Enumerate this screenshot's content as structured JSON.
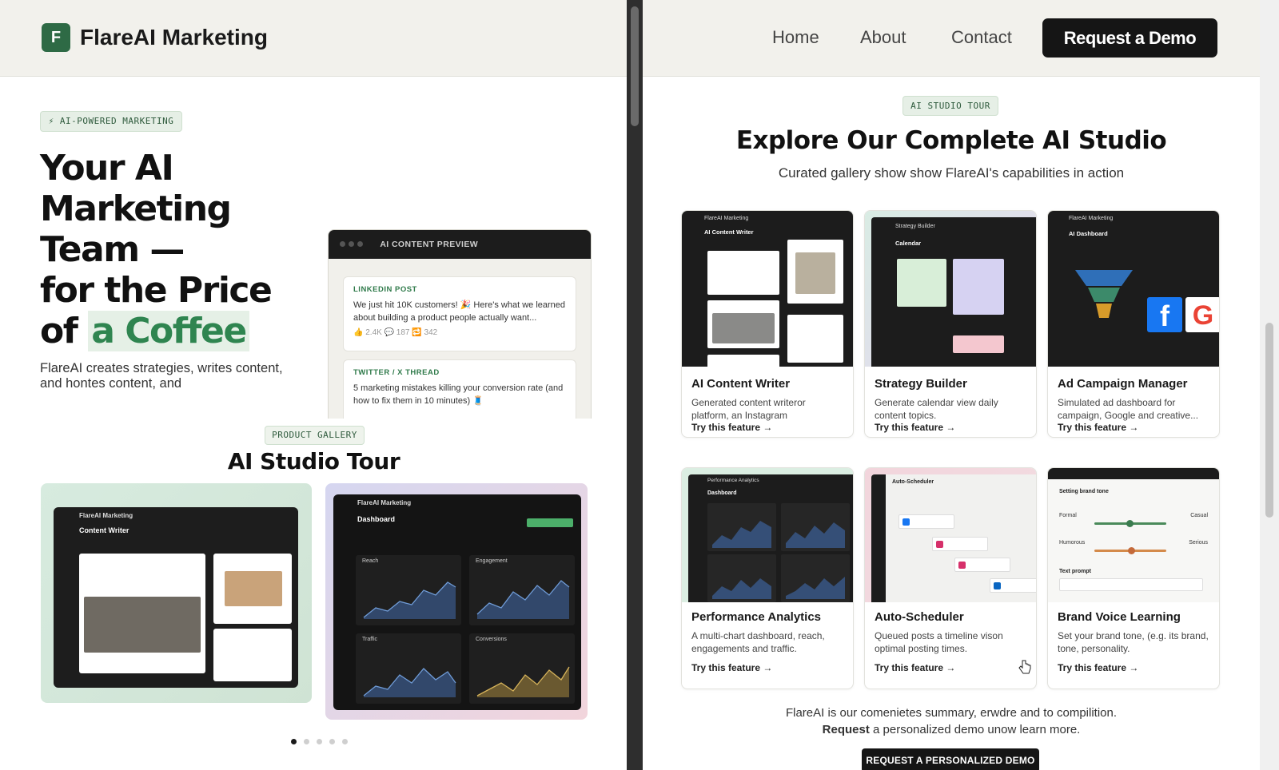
{
  "left": {
    "brand": {
      "initial": "F",
      "name": "FlareAI Marketing"
    },
    "badge": "⚡ AI-POWERED MARKETING",
    "hero": {
      "line1": "Your AI",
      "line2": "Marketing",
      "line3": "Team —",
      "line4": "for the Price",
      "line5_pre": "of ",
      "line5_hl": "a Coffee"
    },
    "lede": "FlareAI creates strategies, writes content, and hontes content, and",
    "preview": {
      "title": "AI CONTENT PREVIEW",
      "cards": [
        {
          "tag": "LINKEDIN POST",
          "body": "We just hit 10K customers! 🎉 Here's what we learned about building a product people actually want...",
          "meta": "👍 2.4K  💬 187  🔁 342"
        },
        {
          "tag": "TWITTER / X THREAD",
          "body": "5 marketing mistakes killing your conversion rate (and how to fix them in 10 minutes) 🧵",
          "meta": ""
        }
      ]
    },
    "gallery": {
      "badge": "PRODUCT GALLERY",
      "title": "AI Studio Tour",
      "shots": [
        {
          "app": "FlareAI Marketing",
          "screen": "Content Writer"
        },
        {
          "app": "FlareAI Marketing",
          "screen": "Dashboard",
          "panels": [
            "Reach",
            "Engagement",
            "Traffic",
            "Conversions"
          ]
        }
      ],
      "dots": 5,
      "active_dot": 1
    }
  },
  "right": {
    "nav": {
      "home": "Home",
      "about": "About",
      "contact": "Contact",
      "cta": "Request a Demo"
    },
    "badge": "AI STUDIO TOUR",
    "title": "Explore Our Complete AI Studio",
    "subtitle": "Curated gallery show show FlareAI's capabilities in action",
    "cards": [
      {
        "title": "AI Content Writer",
        "desc": "Generated content writeror platform, an Instagram",
        "link": "Try this feature →",
        "thumb": "content-writer"
      },
      {
        "title": "Strategy Builder",
        "desc": "Generate calendar view daily content topics.",
        "link": "Try this feature →",
        "thumb": "strategy-builder"
      },
      {
        "title": "Ad Campaign Manager",
        "desc": "Simulated ad dashboard for campaign, Google and creative...",
        "link": "Try this feature →",
        "thumb": "ad-campaign"
      },
      {
        "title": "Performance Analytics",
        "desc": "A multi-chart dashboard, reach, engagements and traffic.",
        "link": "Try this feature →",
        "thumb": "analytics"
      },
      {
        "title": "Auto-Scheduler",
        "desc": "Queued posts a timeline vison optimal posting times.",
        "link": "Try this feature →",
        "thumb": "auto-scheduler"
      },
      {
        "title": "Brand Voice Learning",
        "desc": "Set your brand tone, (e.g. its brand, tone, personality.",
        "link": "Try this feature →",
        "thumb": "brand-voice"
      }
    ],
    "thumb_labels": {
      "cw_app": "FlareAI Marketing",
      "cw_header": "AI Content Writer",
      "sb_app": "Strategy Builder",
      "sb_header": "Calendar",
      "ad_app": "FlareAI Marketing",
      "ad_header": "AI Dashboard",
      "pa_app": "Performance Analytics",
      "pa_header": "Dashboard",
      "as_app": "Auto-Scheduler",
      "bv_header": "Setting brand tone",
      "bv_row1": [
        "Formal",
        "Casual"
      ],
      "bv_row2": [
        "Humorous",
        "Serious"
      ],
      "bv_prompt": "Text prompt"
    },
    "footer": {
      "line1": "FlareAI is our comenietes summary, erwdre and to compilition.",
      "line2_bold": "Request",
      "line2_rest": " a personalized demo unow learn more.",
      "cta": "REQUEST A PERSONALIZED DEMO"
    }
  },
  "colors": {
    "brand": "#2e6a45",
    "accent_green": "#2f8550",
    "dark": "#151515",
    "header_bg": "#f2f1ec"
  }
}
